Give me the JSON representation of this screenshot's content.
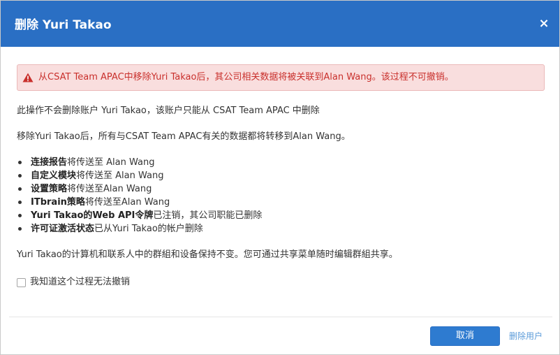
{
  "dialog": {
    "title": "删除 Yuri Takao",
    "close_symbol": "×",
    "header_color": "#2a6fc4"
  },
  "alert": {
    "icon": "warning-triangle-icon",
    "text": "从CSAT Team APAC中移除Yuri Takao后，其公司相关数据将被关联到Alan Wang。该过程不可撤销。",
    "color": "#c9302c",
    "background": "#f9dede"
  },
  "body": {
    "para1": "此操作不会删除账户 Yuri Takao，该账户只能从 CSAT Team APAC 中删除",
    "para2": "移除Yuri Takao后，所有与CSAT Team APAC有关的数据都将转移到Alan Wang。",
    "items": [
      {
        "bold": "连接报告",
        "rest": "将传送至 Alan Wang"
      },
      {
        "bold": "自定义模块",
        "rest": "将传送至 Alan Wang"
      },
      {
        "bold": "设置策略",
        "rest": "将传送至Alan Wang"
      },
      {
        "bold": "ITbrain策略",
        "rest": "将传送至Alan Wang"
      },
      {
        "bold": "Yuri Takao的Web API令牌",
        "rest": "已注销，其公司职能已删除"
      },
      {
        "bold": "许可证激活状态",
        "rest": "已从Yuri Takao的帐户删除"
      }
    ],
    "para3": "Yuri Takao的计算机和联系人中的群組和设备保持不变。您可通过共享菜单随时编辑群組共享。"
  },
  "confirm": {
    "label": "我知道这个过程无法撤销",
    "checked": false
  },
  "footer": {
    "cancel_label": "取消",
    "delete_label": "删除用户",
    "accent": "#2e7bd0"
  }
}
